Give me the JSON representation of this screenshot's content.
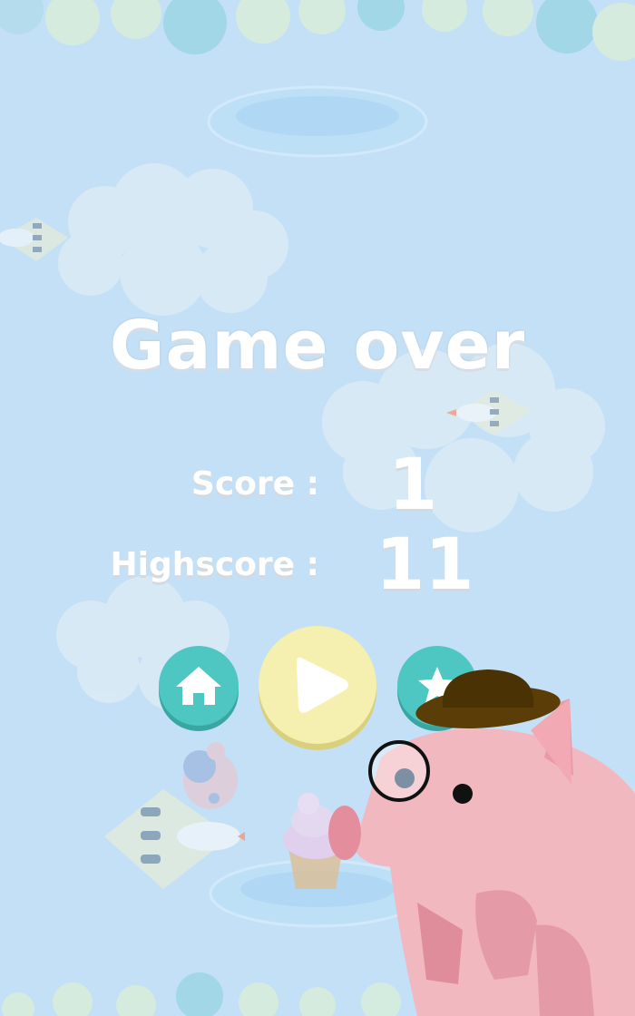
{
  "game": {
    "title": "Game over",
    "score_label": "Score :",
    "score_value": "1",
    "highscore_label": "Highscore :",
    "highscore_value": "11"
  },
  "buttons": {
    "home": {
      "icon": "home-icon"
    },
    "play": {
      "icon": "play-icon"
    },
    "rate": {
      "icon": "star-icon"
    }
  },
  "colors": {
    "sky": "#bcdcf5",
    "button_teal": "#4ec7c3",
    "play_button": "#f5efb0",
    "pig_pink": "#f2b8c0",
    "hat_brown": "#4a3205"
  }
}
